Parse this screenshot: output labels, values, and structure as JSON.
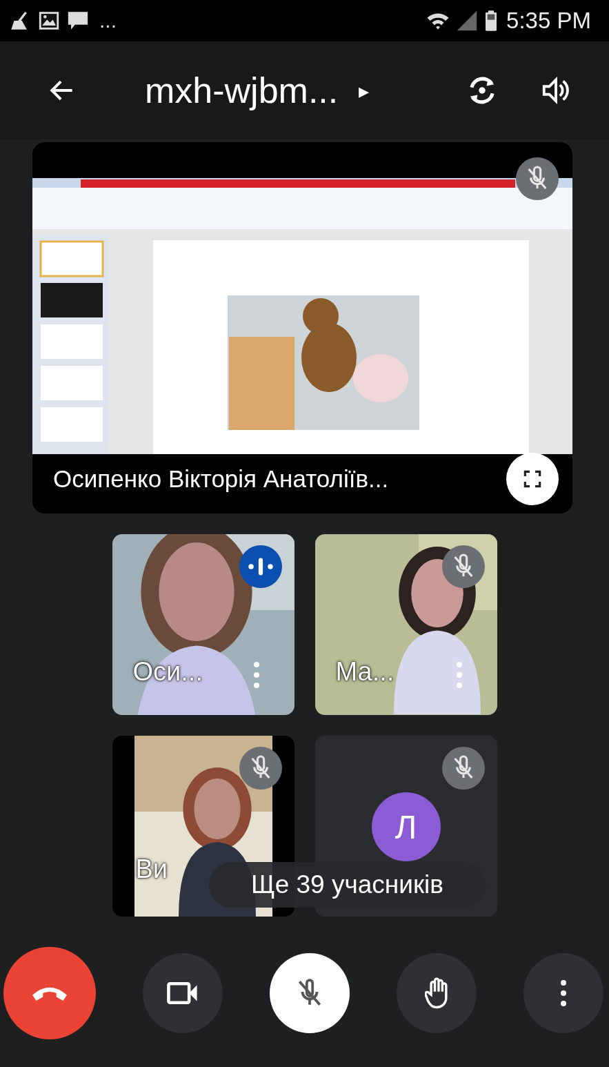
{
  "status_bar": {
    "more": "...",
    "time": "5:35 PM"
  },
  "top_bar": {
    "meeting_code": "mxh-wjbm...",
    "expand": "▸"
  },
  "presentation": {
    "kind": "picture",
    "presenter": "Осипенко Вікторія Анатоліїв...",
    "muted": true
  },
  "tiles": [
    {
      "kind": "video",
      "name": "Оси...",
      "muted": false,
      "menu": true
    },
    {
      "kind": "video",
      "name": "Ма...",
      "muted": true,
      "menu": true
    },
    {
      "kind": "video",
      "name": "Ви",
      "muted": true
    },
    {
      "kind": "avatar",
      "initial": "Л",
      "color": "#8c5cd6",
      "muted": true
    }
  ],
  "more_participants": "Ще 39 учасників",
  "controls": {
    "mic_muted": true
  }
}
